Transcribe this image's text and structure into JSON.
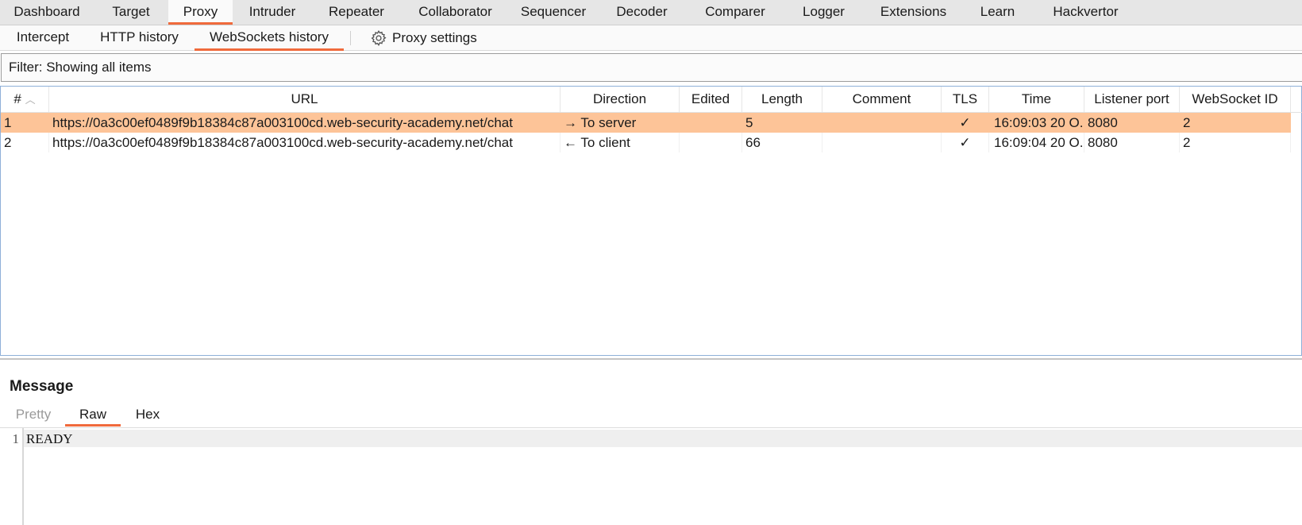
{
  "top_tabs": [
    {
      "label": "Dashboard"
    },
    {
      "label": "Target"
    },
    {
      "label": "Proxy",
      "active": true
    },
    {
      "label": "Intruder"
    },
    {
      "label": "Repeater"
    },
    {
      "label": "Collaborator"
    },
    {
      "label": "Sequencer"
    },
    {
      "label": "Decoder"
    },
    {
      "label": "Comparer"
    },
    {
      "label": "Logger"
    },
    {
      "label": "Extensions"
    },
    {
      "label": "Learn"
    },
    {
      "label": "Hackvertor"
    }
  ],
  "sub_tabs": [
    {
      "label": "Intercept"
    },
    {
      "label": "HTTP history"
    },
    {
      "label": "WebSockets history",
      "active": true
    }
  ],
  "proxy_settings": {
    "label": "Proxy settings",
    "icon": "gear-icon"
  },
  "filter": {
    "text": "Filter: Showing all items"
  },
  "table": {
    "columns": [
      "#",
      "URL",
      "Direction",
      "Edited",
      "Length",
      "Comment",
      "TLS",
      "Time",
      "Listener port",
      "WebSocket ID"
    ],
    "sort_indicator": "^",
    "rows": [
      {
        "num": "1",
        "url": "https://0a3c00ef0489f9b18384c87a003100cd.web-security-academy.net/chat",
        "direction_arrow": "→",
        "direction": "To server",
        "edited": "",
        "length": "5",
        "comment": "",
        "tls": "✓",
        "time": "16:09:03 20 O...",
        "listener_port": "8080",
        "websocket_id": "2",
        "selected": true
      },
      {
        "num": "2",
        "url": "https://0a3c00ef0489f9b18384c87a003100cd.web-security-academy.net/chat",
        "direction_arrow": "←",
        "direction": "To client",
        "edited": "",
        "length": "66",
        "comment": "",
        "tls": "✓",
        "time": "16:09:04 20 O...",
        "listener_port": "8080",
        "websocket_id": "2",
        "selected": false
      }
    ]
  },
  "message": {
    "title": "Message",
    "tabs": [
      {
        "label": "Pretty",
        "disabled": true
      },
      {
        "label": "Raw",
        "active": true
      },
      {
        "label": "Hex"
      }
    ],
    "lines": [
      {
        "number": "1",
        "text": "READY"
      }
    ]
  },
  "colors": {
    "accent": "#f06a3c",
    "selected_row": "#fdc498",
    "table_border": "#8fb0d8"
  }
}
